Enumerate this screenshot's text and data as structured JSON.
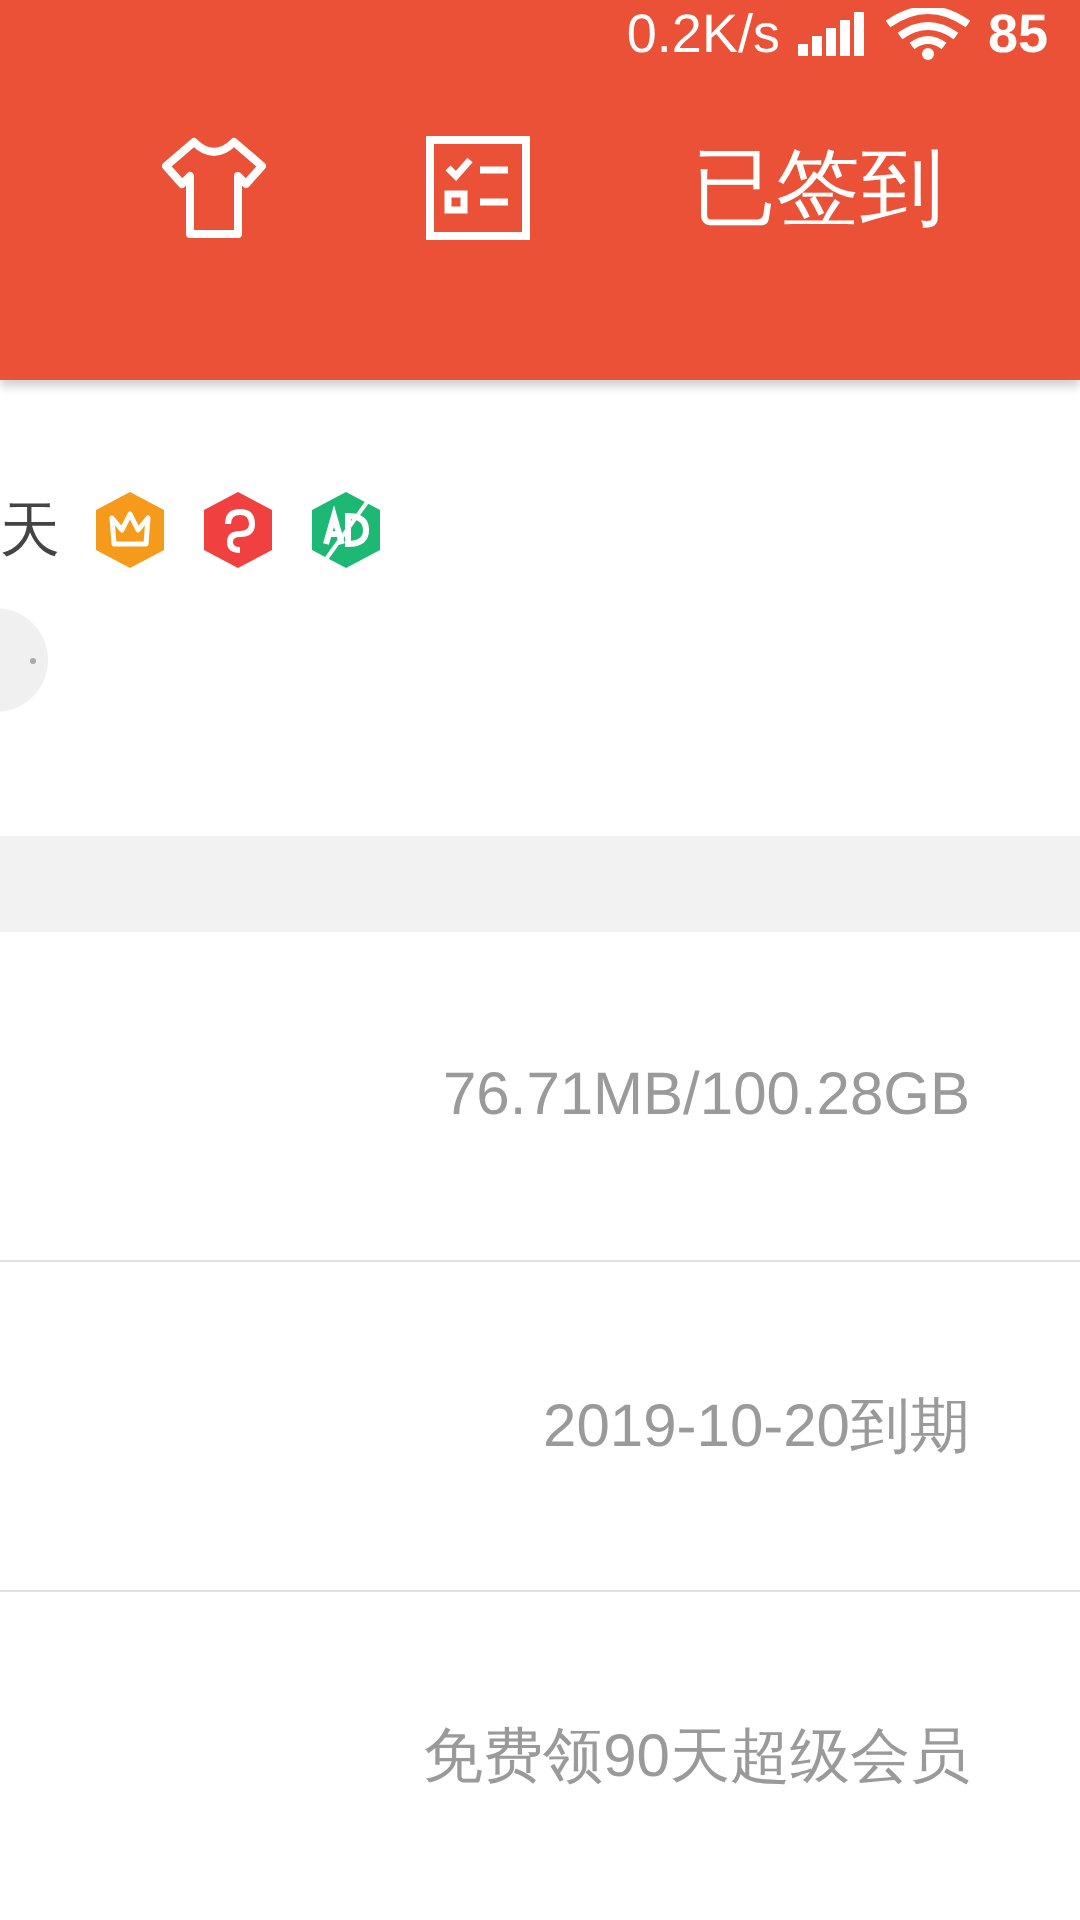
{
  "status_bar": {
    "net_speed": "0.2K/s",
    "battery": "85"
  },
  "header": {
    "sign_in_label": "已签到"
  },
  "profile": {
    "name_tail": "天",
    "badges": [
      {
        "kind": "vip"
      },
      {
        "kind": "p"
      },
      {
        "kind": "ad"
      }
    ]
  },
  "rows": [
    {
      "value": "76.71MB/100.28GB"
    },
    {
      "value": "2019-10-20到期"
    },
    {
      "value": "免费领90天超级会员"
    }
  ]
}
